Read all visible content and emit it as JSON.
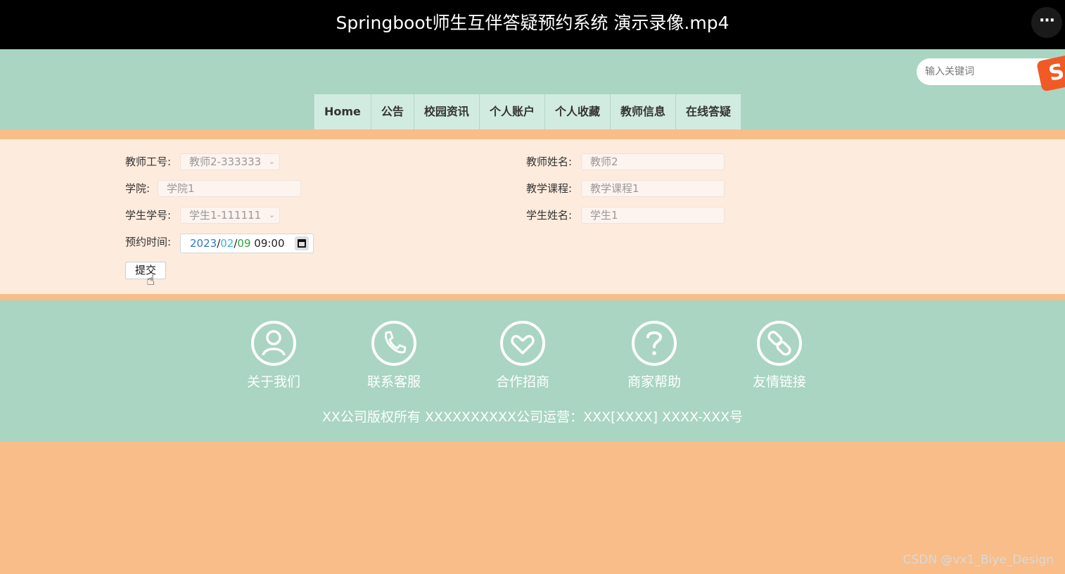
{
  "video": {
    "title": "Springboot师生互伴答疑预约系统 演示录像.mp4",
    "more_label": "···"
  },
  "header": {
    "search_placeholder": "输入关键词",
    "nav": [
      "Home",
      "公告",
      "校园资讯",
      "个人账户",
      "个人收藏",
      "教师信息",
      "在线答疑"
    ],
    "ime_badge": "S"
  },
  "form": {
    "teacher_id_label": "教师工号:",
    "teacher_id_value": "教师2-333333",
    "teacher_name_label": "教师姓名:",
    "teacher_name_placeholder": "教师2",
    "college_label": "学院:",
    "college_placeholder": "学院1",
    "course_label": "教学课程:",
    "course_placeholder": "教学课程1",
    "student_id_label": "学生学号:",
    "student_id_value": "学生1-111111",
    "student_name_label": "学生姓名:",
    "student_name_placeholder": "学生1",
    "time_label": "预约时间:",
    "time_year": "2023",
    "time_sep": "/",
    "time_month": "02",
    "time_day": "09",
    "time_clock": "09:00",
    "submit_label": "提交"
  },
  "footer": {
    "links": [
      {
        "label": "关于我们",
        "icon": "user-icon"
      },
      {
        "label": "联系客服",
        "icon": "phone-icon"
      },
      {
        "label": "合作招商",
        "icon": "heart-icon"
      },
      {
        "label": "商家帮助",
        "icon": "question-icon"
      },
      {
        "label": "友情链接",
        "icon": "link-icon"
      }
    ],
    "copyright": "XX公司版权所有 XXXXXXXXXX公司运营：XXX[XXXX] XXXX-XXX号"
  },
  "watermark": "CSDN @vx1_Biye_Design",
  "colors": {
    "header_green": "#a9d5c2",
    "nav_bg": "#d2ebe1",
    "orange": "#f8bd88",
    "form_bg": "#fdebdd"
  }
}
